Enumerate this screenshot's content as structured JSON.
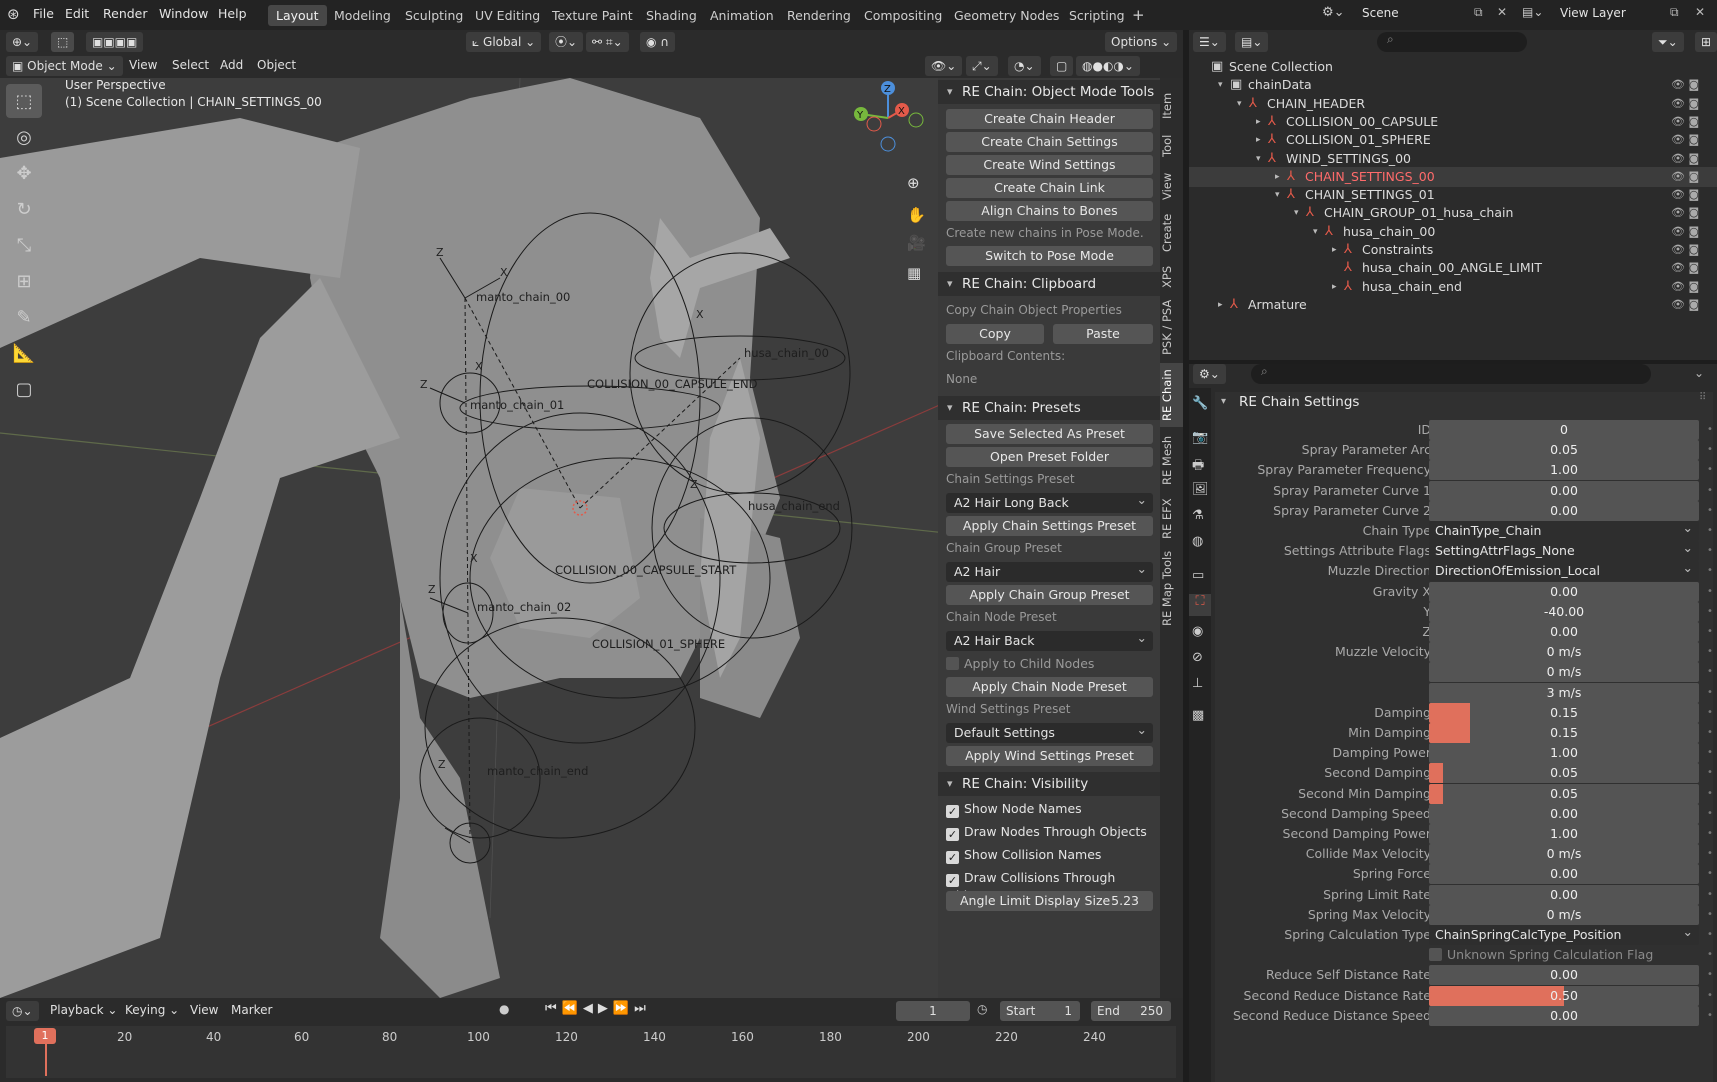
{
  "topbar": {
    "menus": [
      "File",
      "Edit",
      "Render",
      "Window",
      "Help"
    ],
    "workspaces": [
      "Layout",
      "Modeling",
      "Sculpting",
      "UV Editing",
      "Texture Paint",
      "Shading",
      "Animation",
      "Rendering",
      "Compositing",
      "Geometry Nodes",
      "Scripting"
    ],
    "plus": "+",
    "scene": "Scene",
    "view_layer": "View Layer"
  },
  "viewport": {
    "mode": "Object Mode",
    "menus": [
      "View",
      "Select",
      "Add",
      "Object"
    ],
    "transform_orientation": "Global",
    "options": "Options",
    "overlay_line1": "User Perspective",
    "overlay_line2": "(1) Scene Collection | CHAIN_SETTINGS_00",
    "labels": [
      {
        "text": "manto_chain_00",
        "cls": "l1"
      },
      {
        "text": "manto_chain_01",
        "cls": "l2"
      },
      {
        "text": "manto_chain_02",
        "cls": "l3"
      },
      {
        "text": "manto_chain_end",
        "cls": "l4"
      },
      {
        "text": "COLLISION_00_CAPSULE_END",
        "cls": "l5"
      },
      {
        "text": "COLLISION_00_CAPSULE_START",
        "cls": "l6"
      },
      {
        "text": "COLLISION_01_SPHERE",
        "cls": "l7"
      },
      {
        "text": "husa_chain_00",
        "cls": "l8"
      },
      {
        "text": "husa_chain_end",
        "cls": "l9"
      }
    ],
    "gizmo": {
      "x": "X",
      "y": "Y",
      "z": "Z"
    }
  },
  "npanel": {
    "object_mode_tools": {
      "title": "RE Chain: Object Mode Tools",
      "buttons": [
        "Create Chain Header",
        "Create Chain Settings",
        "Create Wind Settings",
        "Create Chain Link",
        "Align Chains to Bones"
      ],
      "hint": "Create new chains in Pose Mode.",
      "switch": "Switch to Pose Mode"
    },
    "clipboard": {
      "title": "RE Chain: Clipboard",
      "copy_label": "Copy Chain Object Properties",
      "copy": "Copy",
      "paste": "Paste",
      "contents_label": "Clipboard Contents:",
      "contents": "None"
    },
    "presets": {
      "title": "RE Chain: Presets",
      "save": "Save Selected As Preset",
      "open": "Open Preset Folder",
      "chain_settings_label": "Chain Settings Preset",
      "chain_settings_value": "A2 Hair Long Back",
      "apply_chain_settings": "Apply Chain Settings Preset",
      "chain_group_label": "Chain Group Preset",
      "chain_group_value": "A2 Hair",
      "apply_chain_group": "Apply Chain Group Preset",
      "chain_node_label": "Chain Node Preset",
      "chain_node_value": "A2 Hair Back",
      "apply_child": "Apply to Child Nodes",
      "apply_chain_node": "Apply Chain Node Preset",
      "wind_label": "Wind Settings Preset",
      "wind_value": "Default Settings",
      "apply_wind": "Apply Wind Settings Preset"
    },
    "visibility": {
      "title": "RE Chain: Visibility",
      "checks": [
        "Show Node Names",
        "Draw Nodes Through Objects",
        "Show Collision Names",
        "Draw Collisions Through Objects"
      ],
      "angle_label": "Angle Limit Display Size",
      "angle_value": "5.23"
    }
  },
  "vtabs": [
    "Item",
    "Tool",
    "View",
    "Create",
    "XPS",
    "PSK / PSA",
    "RE Chain",
    "RE Mesh",
    "RE EFX",
    "RE Map Tools"
  ],
  "timeline": {
    "menus": [
      "Playback",
      "Keying",
      "View",
      "Marker"
    ],
    "current_frame": "1",
    "start_label": "Start",
    "start": "1",
    "end_label": "End",
    "end": "250",
    "ticks": [
      "1",
      "20",
      "40",
      "60",
      "80",
      "100",
      "120",
      "140",
      "160",
      "180",
      "200",
      "220",
      "240"
    ]
  },
  "outliner": {
    "rows": [
      {
        "text": "Scene Collection",
        "indent": 0,
        "exp": ""
      },
      {
        "text": "chainData",
        "indent": 1,
        "exp": "▾"
      },
      {
        "text": "CHAIN_HEADER",
        "indent": 2,
        "exp": "▾"
      },
      {
        "text": "COLLISION_00_CAPSULE",
        "indent": 3,
        "exp": "▸"
      },
      {
        "text": "COLLISION_01_SPHERE",
        "indent": 3,
        "exp": "▸"
      },
      {
        "text": "WIND_SETTINGS_00",
        "indent": 3,
        "exp": "▾"
      },
      {
        "text": "CHAIN_SETTINGS_00",
        "indent": 4,
        "exp": "▸",
        "sel": true
      },
      {
        "text": "CHAIN_SETTINGS_01",
        "indent": 4,
        "exp": "▾"
      },
      {
        "text": "CHAIN_GROUP_01_husa_chain",
        "indent": 5,
        "exp": "▾"
      },
      {
        "text": "husa_chain_00",
        "indent": 6,
        "exp": "▾"
      },
      {
        "text": "Constraints",
        "indent": 7,
        "exp": "▸"
      },
      {
        "text": "husa_chain_00_ANGLE_LIMIT",
        "indent": 7,
        "exp": ""
      },
      {
        "text": "husa_chain_end",
        "indent": 7,
        "exp": "▸"
      },
      {
        "text": "Armature",
        "indent": 1,
        "exp": "▸"
      }
    ]
  },
  "props": {
    "title": "RE Chain Settings",
    "rows": [
      {
        "label": "ID",
        "value": "0"
      },
      {
        "label": "Spray Parameter Arc",
        "value": "0.05"
      },
      {
        "label": "Spray Parameter Frequency",
        "value": "1.00"
      },
      {
        "label": "Spray Parameter Curve 1",
        "value": "0.00"
      },
      {
        "label": "Spray Parameter Curve 2",
        "value": "0.00"
      },
      {
        "label": "Chain Type",
        "value": "ChainType_Chain",
        "drop": true
      },
      {
        "label": "Settings Attribute Flags",
        "value": "SettingAttrFlags_None",
        "drop": true
      },
      {
        "label": "Muzzle Direction",
        "value": "DirectionOfEmission_Local",
        "drop": true
      },
      {
        "label": "Gravity X",
        "value": "0.00"
      },
      {
        "label": "Y",
        "value": "-40.00"
      },
      {
        "label": "Z",
        "value": "0.00"
      },
      {
        "label": "Muzzle Velocity",
        "value": "0 m/s"
      },
      {
        "label": "",
        "value": "0 m/s"
      },
      {
        "label": "",
        "value": "3 m/s"
      },
      {
        "label": "Damping",
        "value": "0.15",
        "fill": 0.15
      },
      {
        "label": "Min Damping",
        "value": "0.15",
        "fill": 0.15
      },
      {
        "label": "Damping Power",
        "value": "1.00"
      },
      {
        "label": "Second Damping",
        "value": "0.05",
        "fill": 0.05
      },
      {
        "label": "Second Min Damping",
        "value": "0.05",
        "fill": 0.05
      },
      {
        "label": "Second Damping Speed",
        "value": "0.00"
      },
      {
        "label": "Second Damping Power",
        "value": "1.00"
      },
      {
        "label": "Collide Max Velocity",
        "value": "0 m/s"
      },
      {
        "label": "Spring Force",
        "value": "0.00"
      },
      {
        "label": "Spring Limit Rate",
        "value": "0.00"
      },
      {
        "label": "Spring Max Velocity",
        "value": "0 m/s"
      },
      {
        "label": "Spring Calculation Type",
        "value": "ChainSpringCalcType_Position",
        "drop": true
      },
      {
        "label": "Unknown Spring Calculation Flag",
        "value": "",
        "check": true
      },
      {
        "label": "Reduce Self Distance Rate",
        "value": "0.00"
      },
      {
        "label": "Second Reduce Distance Rate",
        "value": "0.50",
        "fill": 0.5
      },
      {
        "label": "Second Reduce Distance Speed",
        "value": "0.00"
      }
    ]
  },
  "colors": {
    "accent": "#e0705c",
    "selected_text": "#ff6b6b",
    "panel": "#3a3a3a"
  }
}
